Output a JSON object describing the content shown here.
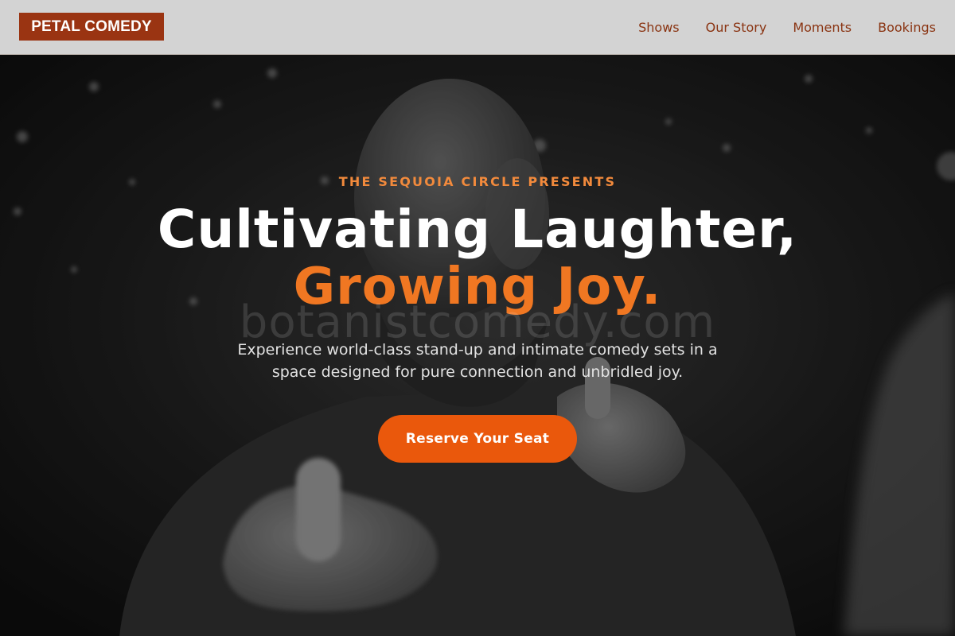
{
  "brand": {
    "logo_text": "PETAL COMEDY",
    "color": "#9a3412"
  },
  "nav": {
    "items": [
      {
        "label": "Shows"
      },
      {
        "label": "Our Story"
      },
      {
        "label": "Moments"
      },
      {
        "label": "Bookings"
      }
    ],
    "link_color": "#8a3412",
    "bar_color": "#d3d3d3"
  },
  "hero": {
    "eyebrow": "THE SEQUOIA CIRCLE PRESENTS",
    "headline_line1": "Cultivating Laughter,",
    "headline_line2": "Growing Joy.",
    "watermark": "botanistcomedy.com",
    "subtitle": "Experience world-class stand-up and intimate comedy sets in a space designed for pure connection and unbridled joy.",
    "cta_label": "Reserve Your Seat",
    "accent_color": "#f07722",
    "cta_color": "#ea580c",
    "background_image": "black-and-white photo of a smiling bald bearded comedian pointing both fingers at the camera"
  }
}
